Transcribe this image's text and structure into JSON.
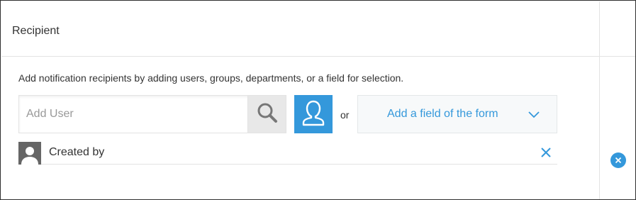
{
  "recipient_section": {
    "title": "Recipient",
    "description": "Add notification recipients by adding users, groups, departments, or a field for selection.",
    "user_input": {
      "placeholder": "Add User",
      "value": ""
    },
    "search_icon": "search-icon",
    "user_select_icon": "user-icon",
    "or_label": "or",
    "field_dropdown_label": "Add a field of the form",
    "recipients": [
      {
        "name": "Created by",
        "avatar_icon": "user-icon",
        "remove_icon": "close-icon"
      }
    ]
  },
  "delete_icon": "close-circle-icon",
  "colors": {
    "accent": "#3498db",
    "text": "#333333",
    "border": "#e3e3e3",
    "avatar_bg": "#666666",
    "search_bg": "#e8e8e8"
  }
}
